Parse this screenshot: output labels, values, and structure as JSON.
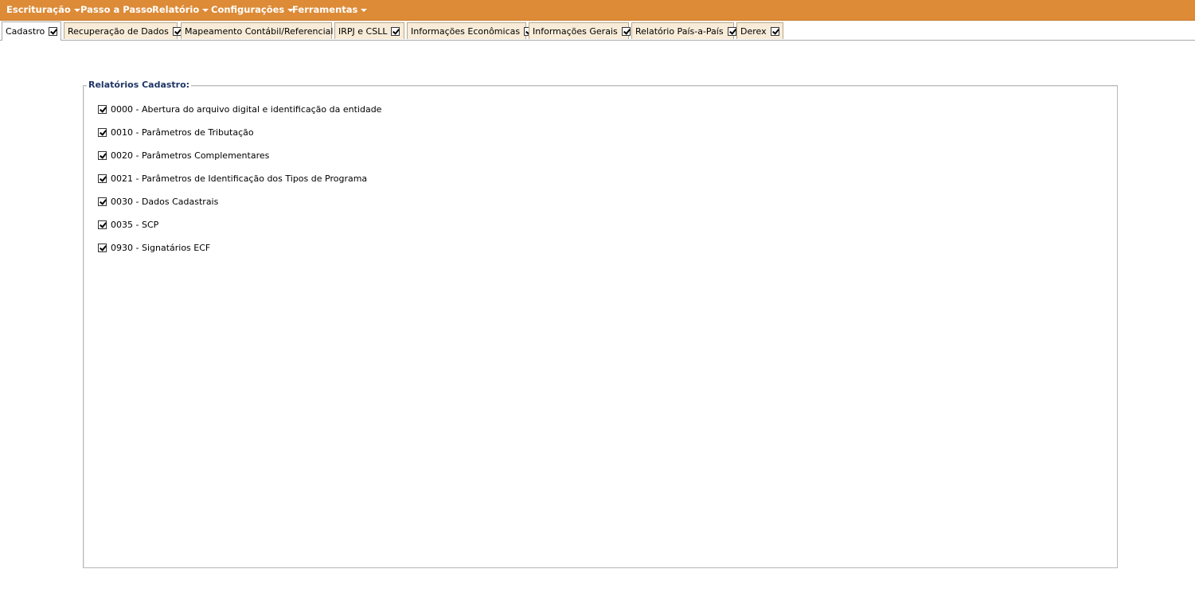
{
  "menu": {
    "items": [
      {
        "label": "Escrituração",
        "dropdown": true
      },
      {
        "label": "Passo a Passo",
        "dropdown": false
      },
      {
        "label": "Relatório",
        "dropdown": true
      },
      {
        "label": "Configurações",
        "dropdown": true
      },
      {
        "label": "Ferramentas",
        "dropdown": true
      }
    ]
  },
  "tabs": [
    {
      "label": "Cadastro",
      "checked": true,
      "active": true
    },
    {
      "label": "Recuperação de Dados",
      "checked": true
    },
    {
      "label": "Mapeamento Contábil/Referencial",
      "checked": true
    },
    {
      "label": "IRPJ e CSLL",
      "checked": true
    },
    {
      "label": "Informações Econômicas",
      "checked": true
    },
    {
      "label": "Informações Gerais",
      "checked": true
    },
    {
      "label": "Relatório País-a-País",
      "checked": true
    },
    {
      "label": "Derex",
      "checked": true
    }
  ],
  "panel": {
    "legend": "Relatórios Cadastro:",
    "items": [
      {
        "label": "0000 - Abertura do arquivo digital e identificação da entidade",
        "checked": true
      },
      {
        "label": "0010 - Parâmetros de Tributação",
        "checked": true
      },
      {
        "label": "0020 - Parâmetros Complementares",
        "checked": true
      },
      {
        "label": "0021 - Parâmetros de Identificação dos Tipos de Programa",
        "checked": true
      },
      {
        "label": "0030 - Dados Cadastrais",
        "checked": true
      },
      {
        "label": "0035 - SCP",
        "checked": true
      },
      {
        "label": "0930 - Signatários ECF",
        "checked": true
      }
    ]
  },
  "colors": {
    "menubar": "#dd8b37",
    "tab_background": "#f8ecd8",
    "legend_text": "#1f3565"
  }
}
